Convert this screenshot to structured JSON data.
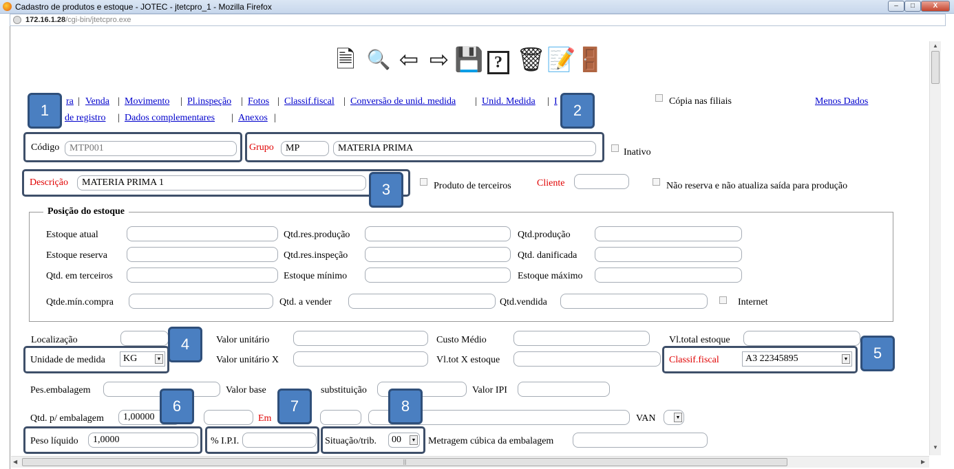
{
  "window": {
    "title": "Cadastro de produtos e estoque - JOTEC - jtetcpro_1 - Mozilla Firefox",
    "url_host": "172.16.1.28",
    "url_path": "/cgi-bin/jtetcpro.exe"
  },
  "toolbar": {
    "icons": [
      "new-document-icon",
      "binoculars-icon",
      "arrow-left-icon",
      "arrow-right-icon",
      "save-disk-icon",
      "help-icon",
      "trash-icon",
      "notepad-icon",
      "exit-door-icon"
    ]
  },
  "nav": {
    "links": [
      "ra",
      "Venda",
      "Movimento",
      "Pl.inspeção",
      "Fotos",
      "Classif.fiscal",
      "Conversão de unid. medida",
      "Unid. Medida",
      "I"
    ],
    "links2": [
      "de registro",
      "Dados complementares",
      "Anexos"
    ],
    "copia_filiais": "Cópia nas filiais",
    "menos_dados": "Menos Dados"
  },
  "form": {
    "codigo_label": "Código",
    "codigo_value": "MTP001",
    "grupo_label": "Grupo",
    "grupo_code": "MP",
    "grupo_desc": "MATERIA PRIMA",
    "inativo": "Inativo",
    "descricao_label": "Descrição",
    "descricao_value": "MATERIA PRIMA 1",
    "produto_terceiros": "Produto de terceiros",
    "cliente_label": "Cliente",
    "nao_reserva": "Não reserva e não atualiza saída para produção"
  },
  "stock": {
    "legend": "Posição do estoque",
    "estoque_atual": "Estoque atual",
    "qtd_res_producao": "Qtd.res.produção",
    "qtd_producao": "Qtd.produção",
    "estoque_reserva": "Estoque reserva",
    "qtd_res_inspecao": "Qtd.res.inspeção",
    "qtd_danificada": "Qtd. danificada",
    "qtd_em_terceiros": "Qtd. em terceiros",
    "estoque_minimo": "Estoque mínimo",
    "estoque_maximo": "Estoque máximo",
    "qtde_min_compra": "Qtde.mín.compra",
    "qtd_a_vender": "Qtd. a vender",
    "qtd_vendida": "Qtd.vendida",
    "internet": "Internet"
  },
  "values": {
    "localizacao": "Localização",
    "valor_unitario": "Valor unitário",
    "custo_medio": "Custo Médio",
    "vl_total_estoque": "Vl.total estoque",
    "unidade_medida_label": "Unidade de medida",
    "unidade_medida_value": "KG",
    "valor_unitario_x": "Valor unitário X",
    "vl_tot_x_estoque": "Vl.tot X estoque",
    "classif_fiscal_label": "Classif.fiscal",
    "classif_fiscal_value": "A3 22345895",
    "pes_embalagem": "Pes.embalagem",
    "valor_base": "Valor base",
    "substituicao": "substituição",
    "valor_ipi": "Valor IPI",
    "qtd_p_embalagem_label": "Qtd. p/ embalagem",
    "qtd_p_embalagem_value": "1,00000",
    "em_label": "Em",
    "van": "VAN",
    "peso_liquido_label": "Peso líquido",
    "peso_liquido_value": "1,0000",
    "pct_ipi": "% I.P.I.",
    "situacao_trib_label": "Situação/trib.",
    "situacao_trib_value": "00",
    "metragem": "Metragem cúbica da embalagem"
  },
  "badges": [
    "1",
    "2",
    "3",
    "4",
    "5",
    "6",
    "7",
    "8"
  ]
}
